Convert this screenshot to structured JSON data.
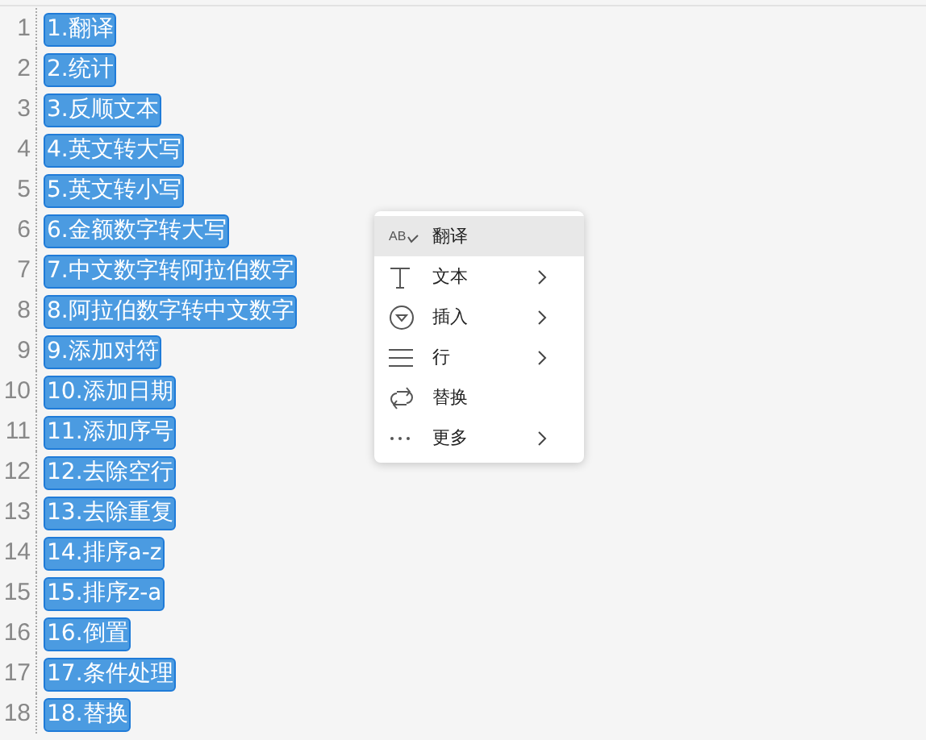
{
  "editor": {
    "lines": [
      {
        "number": "1",
        "text": "1.翻译",
        "selected": true
      },
      {
        "number": "2",
        "text": "2.统计",
        "selected": true
      },
      {
        "number": "3",
        "text": "3.反顺文本",
        "selected": true
      },
      {
        "number": "4",
        "text": "4.英文转大写",
        "selected": true
      },
      {
        "number": "5",
        "text": "5.英文转小写",
        "selected": true
      },
      {
        "number": "6",
        "text": "6.金额数字转大写",
        "selected": true
      },
      {
        "number": "7",
        "text": "7.中文数字转阿拉伯数字",
        "selected": true
      },
      {
        "number": "8",
        "text": "8.阿拉伯数字转中文数字",
        "selected": true
      },
      {
        "number": "9",
        "text": "9.添加对符",
        "selected": true
      },
      {
        "number": "10",
        "text": "10.添加日期",
        "selected": true
      },
      {
        "number": "11",
        "text": "11.添加序号",
        "selected": true
      },
      {
        "number": "12",
        "text": "12.去除空行",
        "selected": true
      },
      {
        "number": "13",
        "text": "13.去除重复",
        "selected": true
      },
      {
        "number": "14",
        "text": "14.排序a-z",
        "selected": true
      },
      {
        "number": "15",
        "text": "15.排序z-a",
        "selected": true
      },
      {
        "number": "16",
        "text": "16.倒置",
        "selected": true
      },
      {
        "number": "17",
        "text": "17.条件处理",
        "selected": true
      },
      {
        "number": "18",
        "text": "18.替换",
        "selected": true
      }
    ]
  },
  "context_menu": {
    "items": [
      {
        "kind": "translate",
        "icon_text": "AB",
        "label": "翻译",
        "submenu": false,
        "selected": true
      },
      {
        "kind": "text",
        "label": "文本",
        "submenu": true,
        "selected": false
      },
      {
        "kind": "insert",
        "label": "插入",
        "submenu": true,
        "selected": false
      },
      {
        "kind": "lines",
        "label": "行",
        "submenu": true,
        "selected": false
      },
      {
        "kind": "replace",
        "label": "替换",
        "submenu": false,
        "selected": false
      },
      {
        "kind": "more",
        "label": "更多",
        "submenu": true,
        "selected": false
      }
    ]
  }
}
